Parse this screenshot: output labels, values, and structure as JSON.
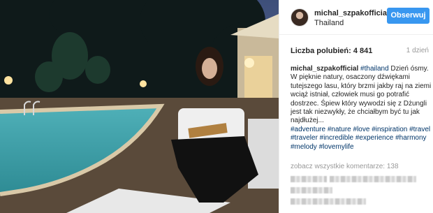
{
  "header": {
    "username": "michal_szpakofficial",
    "location": "Thailand",
    "follow_label": "Obserwuj"
  },
  "stats": {
    "likes": "Liczba polubień: 4 841",
    "time_ago": "1 dzień"
  },
  "caption": {
    "author": "michal_szpakofficial",
    "location_tag": "#thailand",
    "text": "Dzień ósmy. W pięknie natury, osaczony dźwiękami tutejszego lasu, który brzmi jakby raj na ziemi wciąż istniał, człowiek musi go potrafić dostrzec. Śpiew który wywodzi się z Dżungli jest tak niezwykły, że chciałbym być tu jak najdłużej...",
    "hashtags": "#adventure #nature #love #inspiration #travel #traveler #incredible #experience #harmony #melody #lovemylife"
  },
  "comments": {
    "view_all": "zobacz wszystkie komentarze: 138"
  },
  "icons": {
    "follow": "follow-button",
    "avatar": "avatar"
  },
  "colors": {
    "accent": "#3897f0",
    "hashtag": "#003569",
    "muted": "#999999"
  }
}
